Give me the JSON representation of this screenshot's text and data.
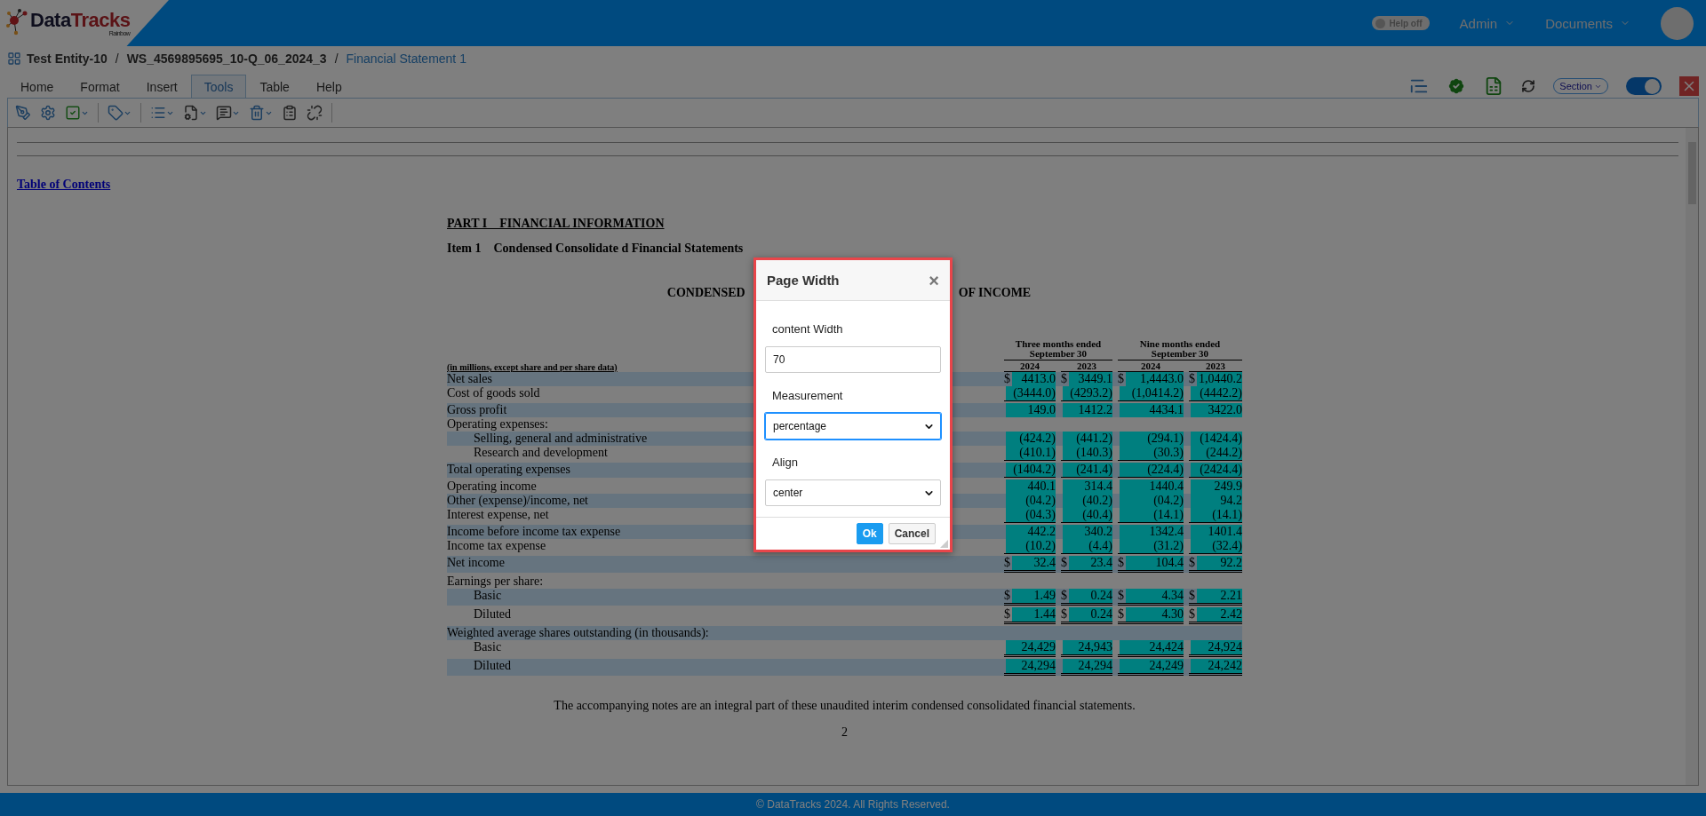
{
  "header": {
    "logo": {
      "first": "Data",
      "second": "Tracks",
      "tagline": "Rainbow"
    },
    "help_toggle": {
      "label": "Help off",
      "on": false
    },
    "menus": [
      "Admin",
      "Documents"
    ]
  },
  "breadcrumb": [
    {
      "kind": "crumb",
      "label": "Test Entity-10"
    },
    {
      "kind": "sep",
      "label": "/"
    },
    {
      "kind": "crumb",
      "label": "WS_4569895695_10-Q_06_2024_3"
    },
    {
      "kind": "sep",
      "label": "/"
    },
    {
      "kind": "link",
      "label": "Financial Statement 1"
    }
  ],
  "tabs": [
    {
      "label": "Home",
      "selected": false
    },
    {
      "label": "Format",
      "selected": false
    },
    {
      "label": "Insert",
      "selected": false
    },
    {
      "label": "Tools",
      "selected": true
    },
    {
      "label": "Table",
      "selected": false
    },
    {
      "label": "Help",
      "selected": false
    }
  ],
  "right_tools": {
    "section_dropdown": "Section",
    "toggle_on": true
  },
  "document": {
    "toc_link": "Table of Contents",
    "part_heading": "PART I    FINANCIAL INFORMATION",
    "item_heading": "Item 1    Condensed Consolidate d Financial Statements",
    "statement_title_left": "CONDENSED",
    "statement_title_right": "OF INCOME",
    "column_groups": [
      "Three months ended September 30",
      "Nine months ended September 30"
    ],
    "years": [
      "2024",
      "2023",
      "2024",
      "2023"
    ],
    "units_label": "(in millions, except share and per share data)",
    "rows": [
      {
        "label": "Net sales",
        "shaded": true,
        "cells": [
          {
            "prefix": "$",
            "value": "4413.0"
          },
          {
            "prefix": "$",
            "value": "3449.1"
          },
          {
            "prefix": "$",
            "value": "1,4443.0"
          },
          {
            "prefix": "$",
            "value": "1,0440.2"
          }
        ]
      },
      {
        "label": "Cost of goods sold",
        "shaded": false,
        "underline": true,
        "cells": [
          {
            "value": "(3444.0)"
          },
          {
            "value": "(4293.2)"
          },
          {
            "value": "(1,0414.2)"
          },
          {
            "value": "(4442.2)"
          }
        ]
      },
      {
        "label": "Gross profit",
        "shaded": true,
        "cells": [
          {
            "value": "149.0"
          },
          {
            "value": "1412.2"
          },
          {
            "value": "4434.1"
          },
          {
            "value": "3422.0"
          }
        ]
      },
      {
        "label": "Operating expenses:",
        "shaded": false,
        "children": [
          {
            "label": "Selling, general and administrative",
            "shaded": true,
            "cells": [
              {
                "value": "(424.2)"
              },
              {
                "value": "(441.2)"
              },
              {
                "value": "(294.1)"
              },
              {
                "value": "(1424.4)"
              }
            ]
          },
          {
            "label": "Research and development",
            "shaded": false,
            "underline": true,
            "cells": [
              {
                "value": "(410.1)"
              },
              {
                "value": "(140.3)"
              },
              {
                "value": "(30.3)"
              },
              {
                "value": "(244.2)"
              }
            ]
          }
        ]
      },
      {
        "label": "Total operating expenses",
        "shaded": true,
        "underline": true,
        "cells": [
          {
            "value": "(1404.2)"
          },
          {
            "value": "(241.4)"
          },
          {
            "value": "(224.4)"
          },
          {
            "value": "(2424.4)"
          }
        ]
      },
      {
        "label": "Operating income",
        "shaded": false,
        "cells": [
          {
            "value": "440.1"
          },
          {
            "value": "314.4"
          },
          {
            "value": "1440.4"
          },
          {
            "value": "249.9"
          }
        ]
      },
      {
        "label": "Other (expense)/income, net",
        "shaded": true,
        "cells": [
          {
            "value": "(04.2)"
          },
          {
            "value": "(40.2)"
          },
          {
            "value": "(04.2)"
          },
          {
            "value": "94.2"
          }
        ]
      },
      {
        "label": "Interest expense, net",
        "shaded": false,
        "underline": true,
        "cells": [
          {
            "value": "(04.3)"
          },
          {
            "value": "(40.4)"
          },
          {
            "value": "(14.1)"
          },
          {
            "value": "(14.1)"
          }
        ]
      },
      {
        "label": "Income before income tax expense",
        "shaded": true,
        "cells": [
          {
            "value": "442.2"
          },
          {
            "value": "340.2"
          },
          {
            "value": "1342.4"
          },
          {
            "value": "1401.4"
          }
        ]
      },
      {
        "label": "Income tax expense",
        "shaded": false,
        "underline": true,
        "cells": [
          {
            "value": "(10.2)"
          },
          {
            "value": "(4.4)"
          },
          {
            "value": "(31.2)"
          },
          {
            "value": "(32.4)"
          }
        ]
      },
      {
        "label": "Net income",
        "shaded": true,
        "double_underline": true,
        "cells": [
          {
            "prefix": "$",
            "value": "32.4"
          },
          {
            "prefix": "$",
            "value": "23.4"
          },
          {
            "prefix": "$",
            "value": "104.4"
          },
          {
            "prefix": "$",
            "value": "92.2"
          }
        ]
      },
      {
        "label": "Earnings per share:",
        "shaded": false,
        "children": [
          {
            "label": "Basic",
            "shaded": true,
            "double_underline": true,
            "cells": [
              {
                "prefix": "$",
                "value": "1.49"
              },
              {
                "prefix": "$",
                "value": "0.24"
              },
              {
                "prefix": "$",
                "value": "4.34"
              },
              {
                "prefix": "$",
                "value": "2.21"
              }
            ]
          },
          {
            "label": "Diluted",
            "shaded": false,
            "double_underline": true,
            "cells": [
              {
                "prefix": "$",
                "value": "1.44"
              },
              {
                "prefix": "$",
                "value": "0.24"
              },
              {
                "prefix": "$",
                "value": "4.30"
              },
              {
                "prefix": "$",
                "value": "2.42"
              }
            ]
          }
        ]
      },
      {
        "label": "Weighted average shares outstanding (in thousands):",
        "shaded": true,
        "children": [
          {
            "label": "Basic",
            "shaded": false,
            "double_underline": true,
            "cells": [
              {
                "value": "24,429"
              },
              {
                "value": "24,943"
              },
              {
                "value": "24,424"
              },
              {
                "value": "24,924"
              }
            ]
          },
          {
            "label": "Diluted",
            "shaded": true,
            "double_underline": true,
            "cells": [
              {
                "value": "24,294"
              },
              {
                "value": "24,294"
              },
              {
                "value": "24,249"
              },
              {
                "value": "24,242"
              }
            ]
          }
        ]
      }
    ],
    "footnote": "The accompanying notes are an integral part of these unaudited interim condensed consolidated financial statements.",
    "page_number": "2"
  },
  "dialog": {
    "title": "Page Width",
    "close": "×",
    "fields": [
      {
        "kind": "input",
        "label": "content Width",
        "value": "70",
        "focused": false
      },
      {
        "kind": "select",
        "label": "Measurement",
        "value": "percentage",
        "focused": true
      },
      {
        "kind": "select",
        "label": "Align",
        "value": "center",
        "focused": false
      }
    ],
    "buttons": [
      {
        "label": "Ok",
        "primary": true
      },
      {
        "label": "Cancel",
        "primary": false
      }
    ]
  },
  "footer": "© DataTracks 2024. All Rights Reserved."
}
